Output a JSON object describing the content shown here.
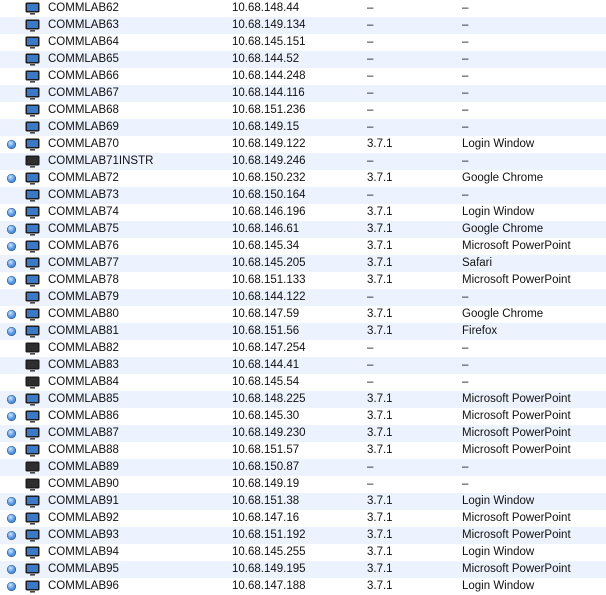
{
  "colors": {
    "row_even": "#edf3fe",
    "row_odd": "#ffffff",
    "status_on": "#3d7fd6",
    "monitor_on": "#3a78c8",
    "monitor_off": "#2e2e2e"
  },
  "rows": [
    {
      "name": "COMMLAB62",
      "ip": "10.68.148.44",
      "version": "–",
      "app": "–",
      "online": false,
      "monitor": "on"
    },
    {
      "name": "COMMLAB63",
      "ip": "10.68.149.134",
      "version": "–",
      "app": "–",
      "online": false,
      "monitor": "on"
    },
    {
      "name": "COMMLAB64",
      "ip": "10.68.145.151",
      "version": "–",
      "app": "–",
      "online": false,
      "monitor": "on"
    },
    {
      "name": "COMMLAB65",
      "ip": "10.68.144.52",
      "version": "–",
      "app": "–",
      "online": false,
      "monitor": "on"
    },
    {
      "name": "COMMLAB66",
      "ip": "10.68.144.248",
      "version": "–",
      "app": "–",
      "online": false,
      "monitor": "on"
    },
    {
      "name": "COMMLAB67",
      "ip": "10.68.144.116",
      "version": "–",
      "app": "–",
      "online": false,
      "monitor": "on"
    },
    {
      "name": "COMMLAB68",
      "ip": "10.68.151.236",
      "version": "–",
      "app": "–",
      "online": false,
      "monitor": "on"
    },
    {
      "name": "COMMLAB69",
      "ip": "10.68.149.15",
      "version": "–",
      "app": "–",
      "online": false,
      "monitor": "on"
    },
    {
      "name": "COMMLAB70",
      "ip": "10.68.149.122",
      "version": "3.7.1",
      "app": "Login Window",
      "online": true,
      "monitor": "on"
    },
    {
      "name": "COMMLAB71INSTR",
      "ip": "10.68.149.246",
      "version": "–",
      "app": "–",
      "online": false,
      "monitor": "off"
    },
    {
      "name": "COMMLAB72",
      "ip": "10.68.150.232",
      "version": "3.7.1",
      "app": "Google Chrome",
      "online": true,
      "monitor": "on"
    },
    {
      "name": "COMMLAB73",
      "ip": "10.68.150.164",
      "version": "–",
      "app": "–",
      "online": false,
      "monitor": "on"
    },
    {
      "name": "COMMLAB74",
      "ip": "10.68.146.196",
      "version": "3.7.1",
      "app": "Login Window",
      "online": true,
      "monitor": "on"
    },
    {
      "name": "COMMLAB75",
      "ip": "10.68.146.61",
      "version": "3.7.1",
      "app": "Google Chrome",
      "online": true,
      "monitor": "on"
    },
    {
      "name": "COMMLAB76",
      "ip": "10.68.145.34",
      "version": "3.7.1",
      "app": "Microsoft PowerPoint",
      "online": true,
      "monitor": "on"
    },
    {
      "name": "COMMLAB77",
      "ip": "10.68.145.205",
      "version": "3.7.1",
      "app": "Safari",
      "online": true,
      "monitor": "on"
    },
    {
      "name": "COMMLAB78",
      "ip": "10.68.151.133",
      "version": "3.7.1",
      "app": "Microsoft PowerPoint",
      "online": true,
      "monitor": "on"
    },
    {
      "name": "COMMLAB79",
      "ip": "10.68.144.122",
      "version": "–",
      "app": "–",
      "online": false,
      "monitor": "on"
    },
    {
      "name": "COMMLAB80",
      "ip": "10.68.147.59",
      "version": "3.7.1",
      "app": "Google Chrome",
      "online": true,
      "monitor": "on"
    },
    {
      "name": "COMMLAB81",
      "ip": "10.68.151.56",
      "version": "3.7.1",
      "app": "Firefox",
      "online": true,
      "monitor": "on"
    },
    {
      "name": "COMMLAB82",
      "ip": "10.68.147.254",
      "version": "–",
      "app": "–",
      "online": false,
      "monitor": "off"
    },
    {
      "name": "COMMLAB83",
      "ip": "10.68.144.41",
      "version": "–",
      "app": "–",
      "online": false,
      "monitor": "off"
    },
    {
      "name": "COMMLAB84",
      "ip": "10.68.145.54",
      "version": "–",
      "app": "–",
      "online": false,
      "monitor": "off"
    },
    {
      "name": "COMMLAB85",
      "ip": "10.68.148.225",
      "version": "3.7.1",
      "app": "Microsoft PowerPoint",
      "online": true,
      "monitor": "on"
    },
    {
      "name": "COMMLAB86",
      "ip": "10.68.145.30",
      "version": "3.7.1",
      "app": "Microsoft PowerPoint",
      "online": true,
      "monitor": "on"
    },
    {
      "name": "COMMLAB87",
      "ip": "10.68.149.230",
      "version": "3.7.1",
      "app": "Microsoft PowerPoint",
      "online": true,
      "monitor": "on"
    },
    {
      "name": "COMMLAB88",
      "ip": "10.68.151.57",
      "version": "3.7.1",
      "app": "Microsoft PowerPoint",
      "online": true,
      "monitor": "on"
    },
    {
      "name": "COMMLAB89",
      "ip": "10.68.150.87",
      "version": "–",
      "app": "–",
      "online": false,
      "monitor": "off"
    },
    {
      "name": "COMMLAB90",
      "ip": "10.68.149.19",
      "version": "–",
      "app": "–",
      "online": false,
      "monitor": "off"
    },
    {
      "name": "COMMLAB91",
      "ip": "10.68.151.38",
      "version": "3.7.1",
      "app": "Login Window",
      "online": true,
      "monitor": "on"
    },
    {
      "name": "COMMLAB92",
      "ip": "10.68.147.16",
      "version": "3.7.1",
      "app": "Microsoft PowerPoint",
      "online": true,
      "monitor": "on"
    },
    {
      "name": "COMMLAB93",
      "ip": "10.68.151.192",
      "version": "3.7.1",
      "app": "Microsoft PowerPoint",
      "online": true,
      "monitor": "on"
    },
    {
      "name": "COMMLAB94",
      "ip": "10.68.145.255",
      "version": "3.7.1",
      "app": "Login Window",
      "online": true,
      "monitor": "on"
    },
    {
      "name": "COMMLAB95",
      "ip": "10.68.149.195",
      "version": "3.7.1",
      "app": "Microsoft PowerPoint",
      "online": true,
      "monitor": "on"
    },
    {
      "name": "COMMLAB96",
      "ip": "10.68.147.188",
      "version": "3.7.1",
      "app": "Login Window",
      "online": true,
      "monitor": "on"
    }
  ]
}
